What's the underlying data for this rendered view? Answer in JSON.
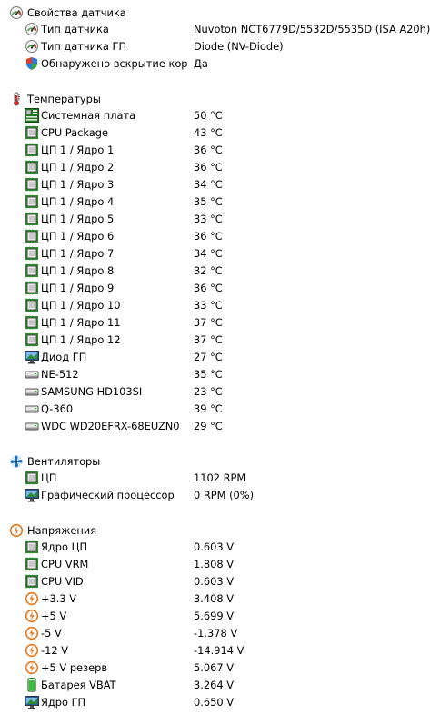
{
  "sensor_props": {
    "title": "Свойства датчика",
    "icon": "gauge-icon",
    "rows": [
      {
        "label": "Тип датчика",
        "value": "Nuvoton NCT6779D/5532D/5535D  (ISA A20h)",
        "icon": "gauge-icon"
      },
      {
        "label": "Тип датчика ГП",
        "value": "Diode  (NV-Diode)",
        "icon": "gauge-icon"
      },
      {
        "label": "Обнаружено вскрытие кор...",
        "value": "Да",
        "icon": "shield-icon"
      }
    ]
  },
  "temperatures": {
    "title": "Температуры",
    "icon": "thermometer-icon",
    "rows": [
      {
        "label": "Системная плата",
        "value": "50 °C",
        "icon": "motherboard-icon"
      },
      {
        "label": "CPU Package",
        "value": "43 °C",
        "icon": "chip-icon"
      },
      {
        "label": "ЦП 1 / Ядро 1",
        "value": "36 °C",
        "icon": "chip-icon"
      },
      {
        "label": "ЦП 1 / Ядро 2",
        "value": "36 °C",
        "icon": "chip-icon"
      },
      {
        "label": "ЦП 1 / Ядро 3",
        "value": "34 °C",
        "icon": "chip-icon"
      },
      {
        "label": "ЦП 1 / Ядро 4",
        "value": "35 °C",
        "icon": "chip-icon"
      },
      {
        "label": "ЦП 1 / Ядро 5",
        "value": "33 °C",
        "icon": "chip-icon"
      },
      {
        "label": "ЦП 1 / Ядро 6",
        "value": "36 °C",
        "icon": "chip-icon"
      },
      {
        "label": "ЦП 1 / Ядро 7",
        "value": "34 °C",
        "icon": "chip-icon"
      },
      {
        "label": "ЦП 1 / Ядро 8",
        "value": "32 °C",
        "icon": "chip-icon"
      },
      {
        "label": "ЦП 1 / Ядро 9",
        "value": "36 °C",
        "icon": "chip-icon"
      },
      {
        "label": "ЦП 1 / Ядро 10",
        "value": "33 °C",
        "icon": "chip-icon"
      },
      {
        "label": "ЦП 1 / Ядро 11",
        "value": "37 °C",
        "icon": "chip-icon"
      },
      {
        "label": "ЦП 1 / Ядро 12",
        "value": "37 °C",
        "icon": "chip-icon"
      },
      {
        "label": "Диод ГП",
        "value": "27 °C",
        "icon": "monitor-icon"
      },
      {
        "label": "NE-512",
        "value": "35 °C",
        "icon": "drive-icon"
      },
      {
        "label": "SAMSUNG HD103SI",
        "value": "23 °C",
        "icon": "drive-icon"
      },
      {
        "label": "Q-360",
        "value": "39 °C",
        "icon": "drive-icon"
      },
      {
        "label": "WDC WD20EFRX-68EUZN0",
        "value": "29 °C",
        "icon": "drive-icon"
      }
    ]
  },
  "fans": {
    "title": "Вентиляторы",
    "icon": "fan-icon",
    "rows": [
      {
        "label": "ЦП",
        "value": "1102 RPM",
        "icon": "chip-icon"
      },
      {
        "label": "Графический процессор",
        "value": "0 RPM  (0%)",
        "icon": "monitor-icon"
      }
    ]
  },
  "voltages": {
    "title": "Напряжения",
    "icon": "voltage-icon",
    "rows": [
      {
        "label": "Ядро ЦП",
        "value": "0.603 V",
        "icon": "chip-icon"
      },
      {
        "label": "CPU VRM",
        "value": "1.808 V",
        "icon": "chip-icon"
      },
      {
        "label": "CPU VID",
        "value": "0.603 V",
        "icon": "chip-icon"
      },
      {
        "label": "+3.3 V",
        "value": "3.408 V",
        "icon": "voltage-icon"
      },
      {
        "label": "+5 V",
        "value": "5.699 V",
        "icon": "voltage-icon"
      },
      {
        "label": "-5 V",
        "value": "-1.378 V",
        "icon": "voltage-icon"
      },
      {
        "label": "-12 V",
        "value": "-14.914 V",
        "icon": "voltage-icon"
      },
      {
        "label": "+5 V резерв",
        "value": "5.067 V",
        "icon": "voltage-icon"
      },
      {
        "label": "Батарея VBAT",
        "value": "3.264 V",
        "icon": "battery-icon"
      },
      {
        "label": "Ядро ГП",
        "value": "0.650 V",
        "icon": "monitor-icon"
      }
    ]
  }
}
